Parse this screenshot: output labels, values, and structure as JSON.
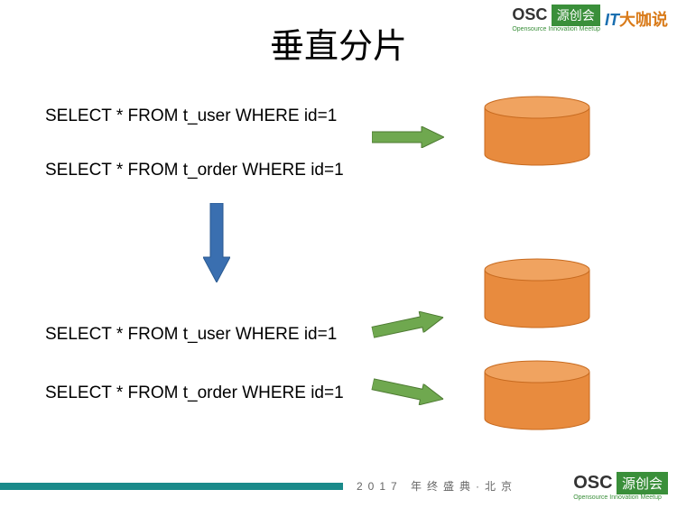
{
  "title": "垂直分片",
  "sql": {
    "before": {
      "q1": "SELECT * FROM t_user WHERE id=1",
      "q2": "SELECT * FROM t_order WHERE id=1"
    },
    "after": {
      "q1": "SELECT * FROM t_user WHERE id=1",
      "q2": "SELECT * FROM t_order WHERE id=1"
    }
  },
  "logos": {
    "osc": {
      "en": "OSC",
      "cn": "源创会",
      "sub": "Opensource Innovation Meetup"
    },
    "it": {
      "prefix": "IT",
      "cn": "大咖说"
    }
  },
  "footer": {
    "text": "2017 年终盛典·北京",
    "osc": {
      "en": "OSC",
      "cn": "源创会",
      "sub": "Opensource Innovation Meetup"
    }
  },
  "colors": {
    "cylinder_fill": "#e88b3e",
    "cylinder_stroke": "#c76a1f",
    "arrow_green": "#6fa84f",
    "arrow_green_stroke": "#4d7a32",
    "arrow_blue": "#3a6fb0",
    "arrow_blue_stroke": "#2a5a90",
    "footer_bar": "#1a8a8a"
  }
}
